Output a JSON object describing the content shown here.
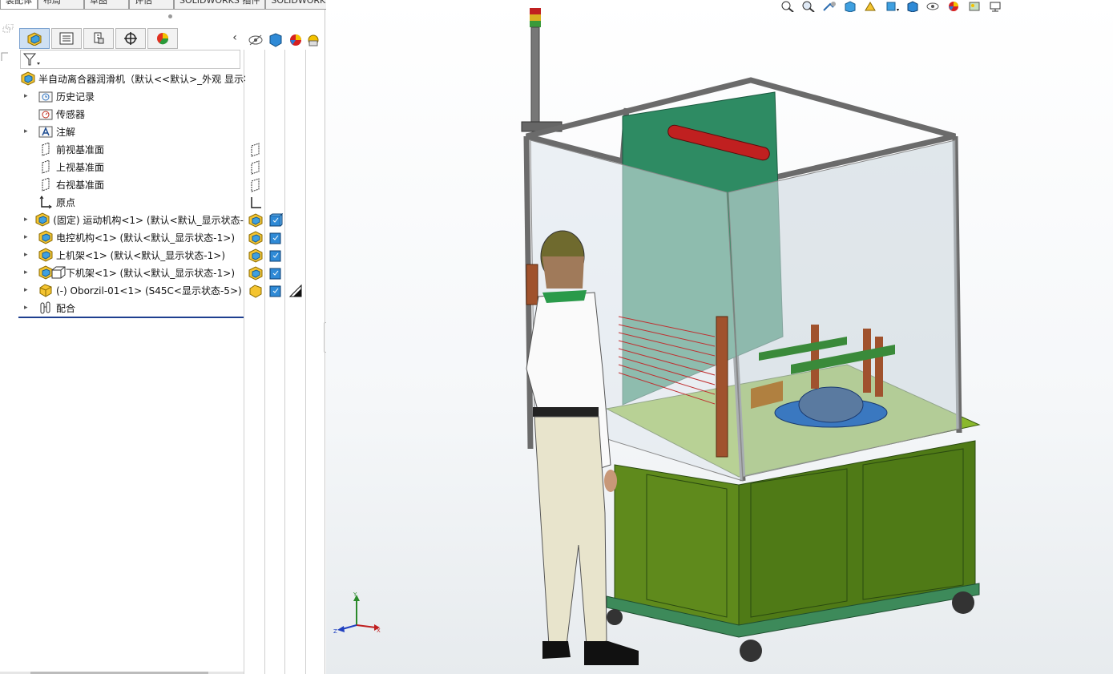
{
  "tabs": [
    "装配体",
    "布局",
    "草图",
    "评估",
    "SOLIDWORKS 插件",
    "SOLIDWORKS MBD"
  ],
  "tree": {
    "root": "半自动离合器润滑机（默认<<默认>_外观 显示状",
    "items": [
      {
        "label": "历史记录",
        "icon": "history-folder-icon"
      },
      {
        "label": "传感器",
        "icon": "sensor-icon"
      },
      {
        "label": "注解",
        "icon": "annotation-icon"
      },
      {
        "label": "前视基准面",
        "icon": "plane-icon"
      },
      {
        "label": "上视基准面",
        "icon": "plane-icon"
      },
      {
        "label": "右视基准面",
        "icon": "plane-icon"
      },
      {
        "label": "原点",
        "icon": "origin-icon"
      },
      {
        "label": "(固定) 运动机构<1> (默认<默认_显示状态-",
        "icon": "assembly-icon"
      },
      {
        "label": "电控机构<1> (默认<默认_显示状态-1>)",
        "icon": "assembly-icon"
      },
      {
        "label": "上机架<1> (默认<默认_显示状态-1>)",
        "icon": "assembly-icon"
      },
      {
        "label": "下机架<1> (默认<默认_显示状态-1>)",
        "icon": "assembly-icon"
      },
      {
        "label": "(-) Oborzil-01<1> (S45C<显示状态-5>)",
        "icon": "part-icon"
      },
      {
        "label": "配合",
        "icon": "mates-icon"
      }
    ]
  },
  "triad": {
    "y": "Y",
    "x": "X",
    "z": "Z"
  },
  "colors": {
    "accent": "#1e3f8f",
    "cabinet": "#5f8a1c",
    "frame": "#3d8a5a",
    "panel": "#2e8b63"
  }
}
